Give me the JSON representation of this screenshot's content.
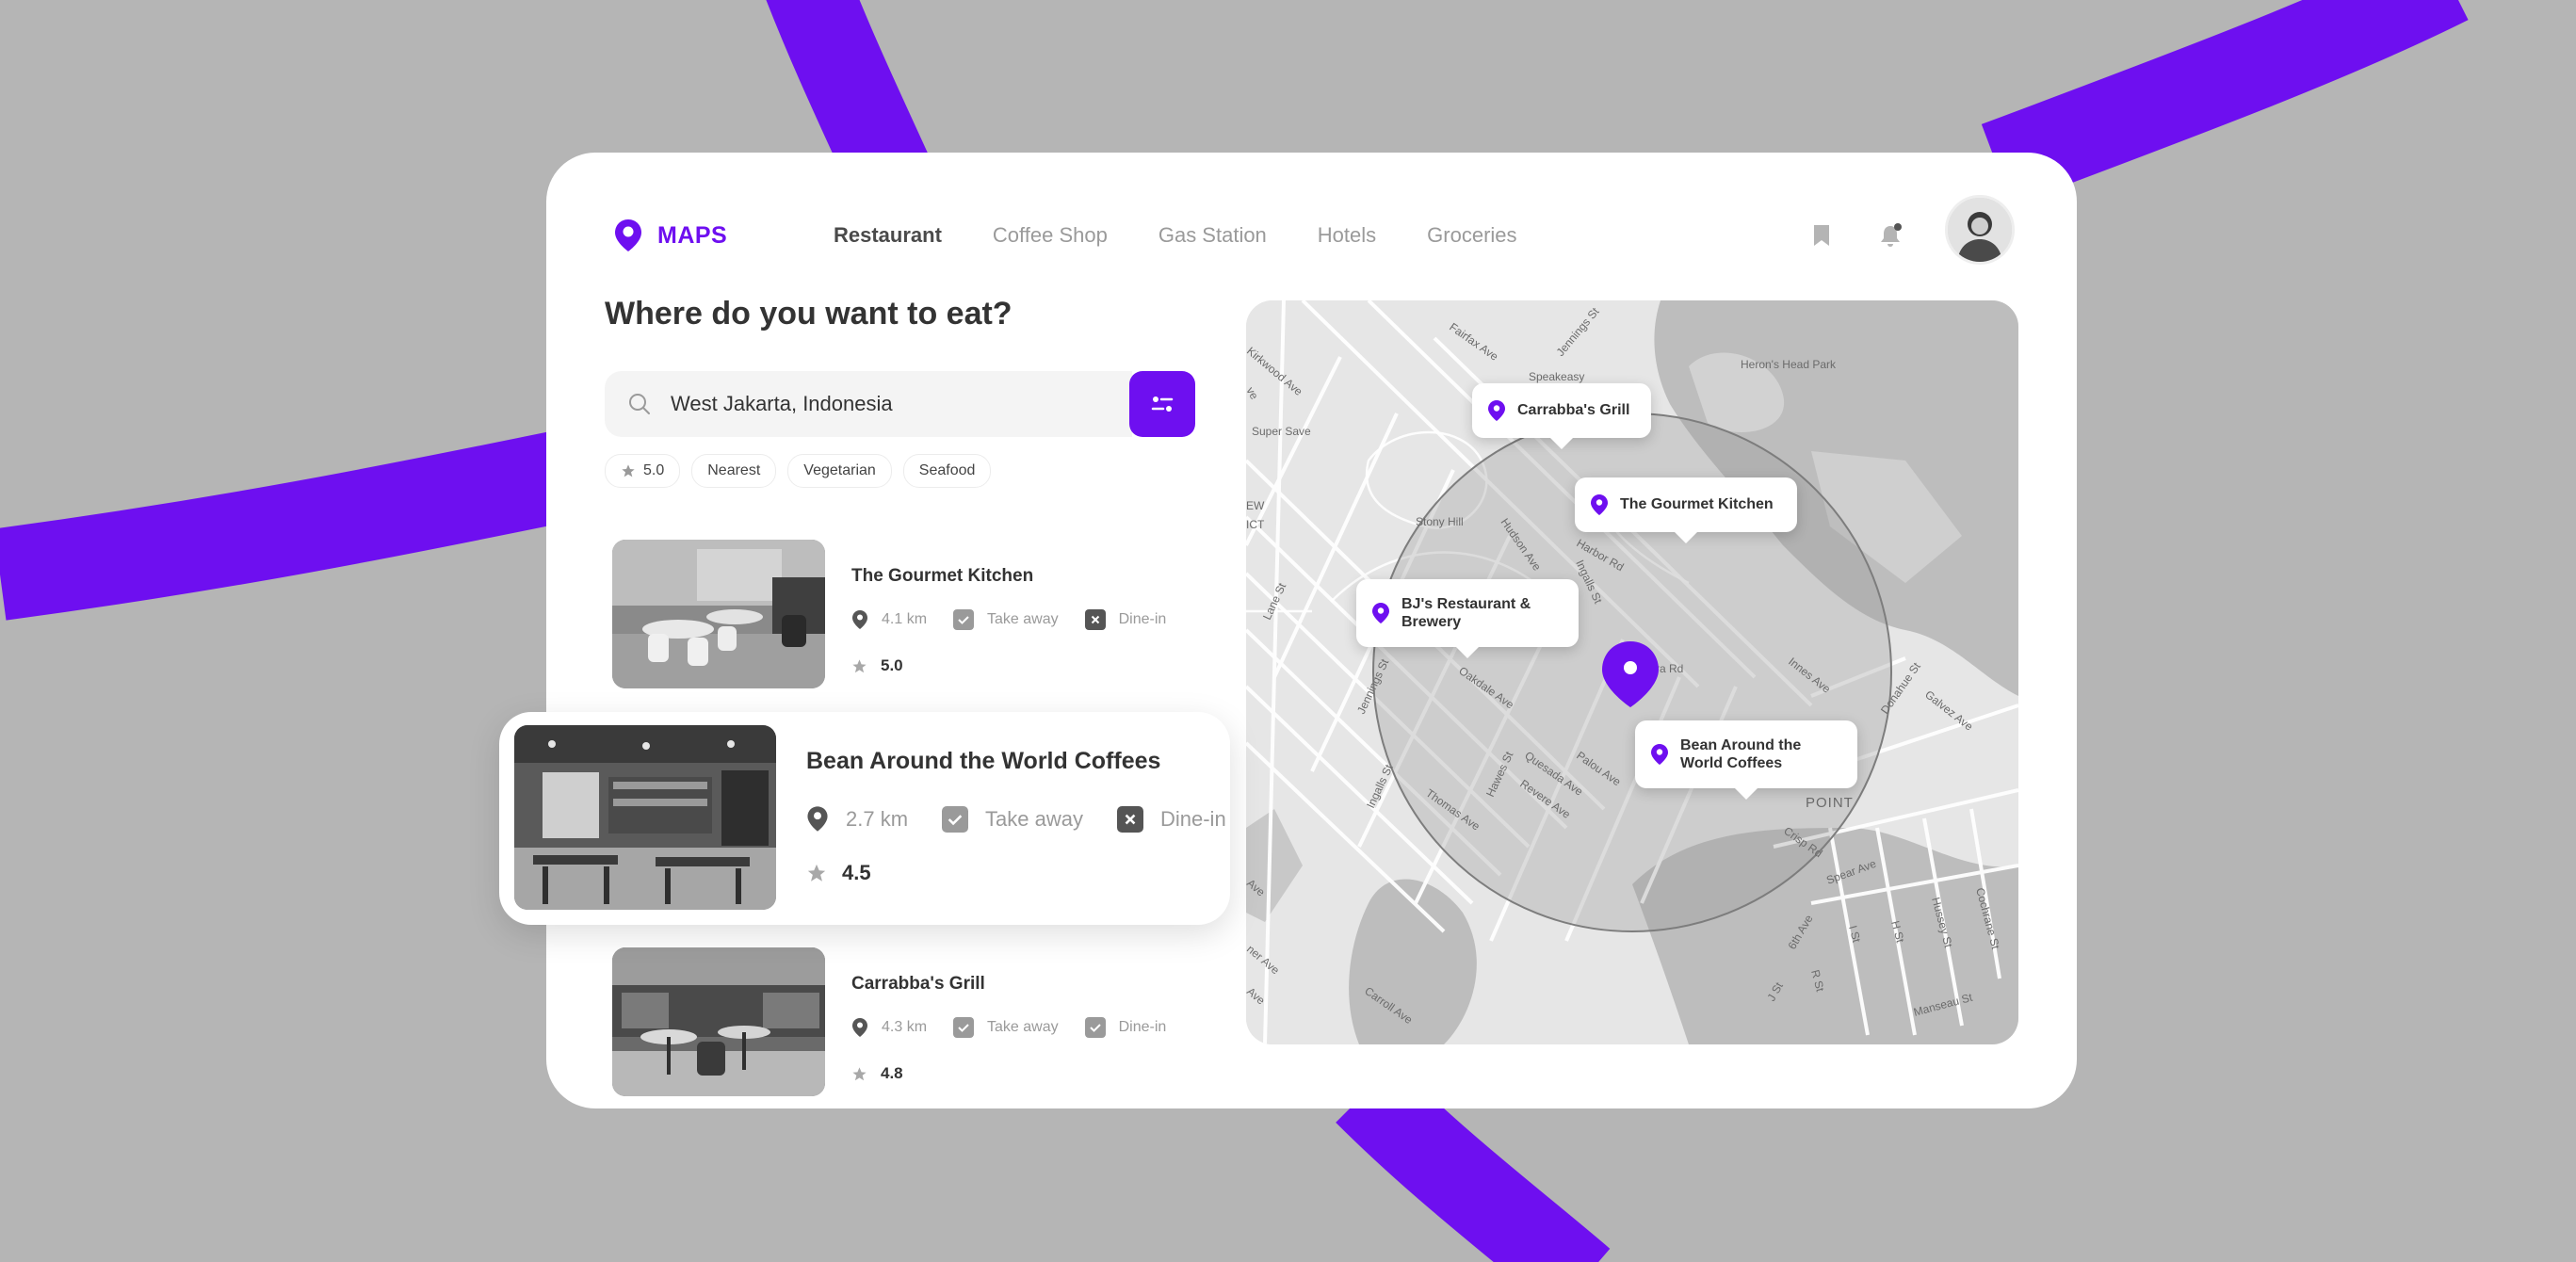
{
  "app": {
    "name": "MAPS"
  },
  "nav": {
    "items": [
      {
        "label": "Restaurant",
        "active": true
      },
      {
        "label": "Coffee Shop",
        "active": false
      },
      {
        "label": "Gas Station",
        "active": false
      },
      {
        "label": "Hotels",
        "active": false
      },
      {
        "label": "Groceries",
        "active": false
      }
    ]
  },
  "header": {
    "icons": [
      "bookmark-icon",
      "bell-icon"
    ],
    "avatar": "user-avatar"
  },
  "headline": "Where do you want to eat?",
  "search": {
    "value": "West Jakarta, Indonesia",
    "placeholder": ""
  },
  "filters": [
    {
      "label": "5.0",
      "icon": "star-icon"
    },
    {
      "label": "Nearest"
    },
    {
      "label": "Vegetarian"
    },
    {
      "label": "Seafood"
    }
  ],
  "restaurants": [
    {
      "name": "The Gourmet Kitchen",
      "distance": "4.1 km",
      "take_away": "Take away",
      "take_away_available": true,
      "dine_in": "Dine-in",
      "dine_in_available": false,
      "rating": "5.0"
    },
    {
      "name": "Bean Around the World Coffees",
      "distance": "2.7 km",
      "take_away": "Take away",
      "take_away_available": true,
      "dine_in": "Dine-in",
      "dine_in_available": false,
      "rating": "4.5",
      "highlighted": true
    },
    {
      "name": "Carrabba's Grill",
      "distance": "4.3 km",
      "take_away": "Take away",
      "take_away_available": true,
      "dine_in": "Dine-in",
      "dine_in_available": true,
      "rating": "4.8"
    }
  ],
  "map": {
    "pins": [
      {
        "label": "Carrabba's Grill"
      },
      {
        "label": "The Gourmet Kitchen"
      },
      {
        "label_line1": "BJ's Restaurant &",
        "label_line2": "Brewery"
      },
      {
        "label_line1": "Bean Around the",
        "label_line2": "World Coffees"
      }
    ],
    "street_labels": {
      "fairfax": "Fairfax Ave",
      "jennings": "Jennings St",
      "heron": "Heron's Head Park",
      "kirkwood": "Kirkwood Ave",
      "speakeasy": "Speakeasy",
      "super_save": "Super Save",
      "ew": "EW",
      "ict": "ICT",
      "stony_hill": "Stony Hill",
      "hudson": "Hudson Ave",
      "harbor": "Harbor Rd",
      "ingalls": "Ingalls St",
      "innes": "Innes Ave",
      "lane": "Lane St",
      "jennings2": "Jennings St",
      "oakdale": "Oakdale Ave",
      "hawes": "Hawes St",
      "quesada": "Quesada Ave",
      "palou": "Palou Ave",
      "revere": "Revere Ave",
      "thomas": "Thomas Ave",
      "ingalls2": "Ingalls St",
      "donahue": "Donahue St",
      "galvez": "Galvez Ave",
      "crisp": "Crisp Rd",
      "point": "POINT",
      "spear": "Spear Ave",
      "sixth": "6th Ave",
      "i_st": "I St",
      "h_st": "H St",
      "hussey": "Hussey St",
      "cochrane": "Cochrane St",
      "j_st": "J St",
      "r_st": "R St",
      "manseau": "Manseau St",
      "carroll": "Carroll Ave",
      "ave": "Ave",
      "ner_ave": "ner Ave",
      "ve": "ve",
      "ra_rd": "ra Rd"
    }
  },
  "colors": {
    "accent": "#6e0ff0",
    "background": "#b5b5b5",
    "card": "#ffffff"
  }
}
